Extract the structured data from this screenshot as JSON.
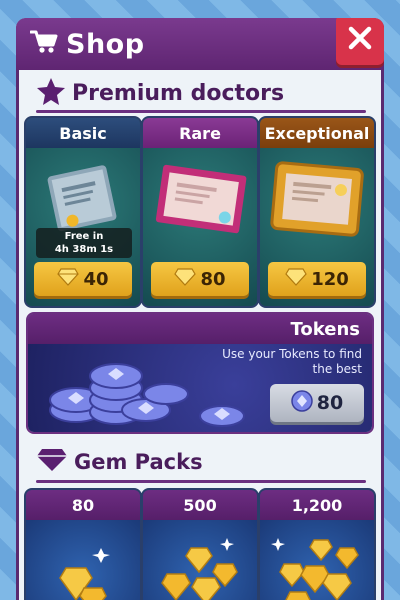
{
  "header": {
    "title": "Shop",
    "cart_icon": "cart-icon",
    "close_icon": "close-icon"
  },
  "premium": {
    "title": "Premium doctors",
    "cards": [
      {
        "label": "Basic",
        "free_line1": "Free in",
        "free_line2": "4h 38m 1s",
        "price": "40",
        "color": "#23406a"
      },
      {
        "label": "Rare",
        "price": "80",
        "color": "#7a2f85"
      },
      {
        "label": "Exceptional",
        "price": "120",
        "color": "#8a4a12"
      }
    ]
  },
  "tokens": {
    "title": "Tokens",
    "description": "Use your Tokens to find the best",
    "price": "80"
  },
  "gem_packs": {
    "title": "Gem Packs",
    "packs": [
      {
        "label": "80"
      },
      {
        "label": "500"
      },
      {
        "label": "1,200"
      }
    ]
  },
  "colors": {
    "panel_header": "#6b2d80",
    "close": "#d8334a",
    "gold": "#f3b92e",
    "teal": "#1f5a5e"
  }
}
